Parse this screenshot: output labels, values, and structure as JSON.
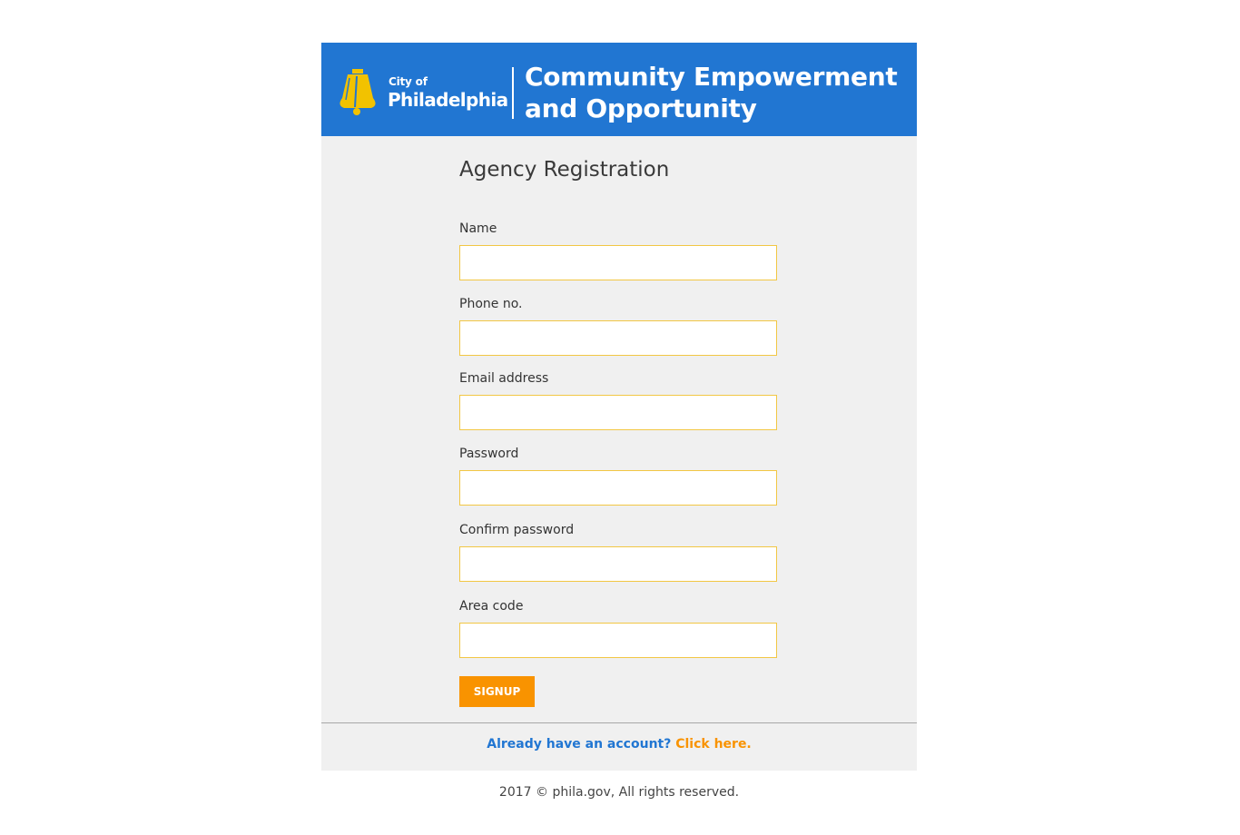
{
  "brand": {
    "city_of": "City of",
    "city_name": "Philadelphia",
    "headline_line1": "Community Empowerment",
    "headline_line2": "and Opportunity",
    "banner_color": "#2176d2",
    "logo_icon": "liberty-bell-icon",
    "logo_color": "#f2c200"
  },
  "form": {
    "title": "Agency Registration",
    "fields": [
      {
        "label": "Name",
        "value": "",
        "type": "text"
      },
      {
        "label": "Phone no.",
        "value": "",
        "type": "tel"
      },
      {
        "label": "Email address",
        "value": "",
        "type": "email"
      },
      {
        "label": "Password",
        "value": "",
        "type": "password"
      },
      {
        "label": "Confirm password",
        "value": "",
        "type": "password"
      },
      {
        "label": "Area code",
        "value": "",
        "type": "text"
      }
    ],
    "submit_label": "SIGNUP",
    "accent_color": "#f99300",
    "field_border_color": "#f2c744"
  },
  "footer": {
    "question": "Already have an account?",
    "link_text": "Click here.",
    "copyright": "2017 © phila.gov, All rights reserved."
  }
}
